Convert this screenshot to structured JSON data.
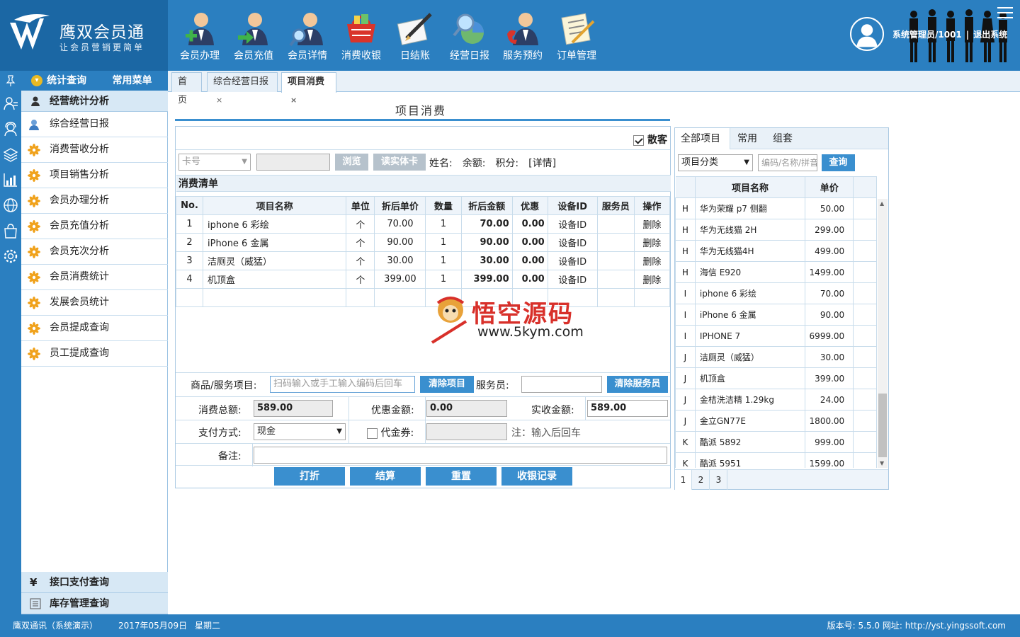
{
  "app": {
    "title": "鹰双会员通",
    "subtitle": "让会员营销更简单",
    "user": "系统管理员/1001",
    "sep": "|",
    "logout": "退出系统"
  },
  "toolbar": [
    {
      "label": "会员办理",
      "icon": "member-register-icon"
    },
    {
      "label": "会员充值",
      "icon": "member-recharge-icon"
    },
    {
      "label": "会员详情",
      "icon": "member-detail-icon"
    },
    {
      "label": "消费收银",
      "icon": "cashier-basket-icon"
    },
    {
      "label": "日结账",
      "icon": "daily-settle-icon"
    },
    {
      "label": "经营日报",
      "icon": "business-report-icon"
    },
    {
      "label": "服务预约",
      "icon": "service-booking-icon"
    },
    {
      "label": "订单管理",
      "icon": "order-manage-icon"
    }
  ],
  "sidebar": {
    "tab_stats": "统计查询",
    "tab_common": "常用菜单",
    "group_title": "经营统计分析",
    "items": [
      {
        "label": "综合经营日报"
      },
      {
        "label": "消费营收分析"
      },
      {
        "label": "项目销售分析"
      },
      {
        "label": "会员办理分析"
      },
      {
        "label": "会员充值分析"
      },
      {
        "label": "会员充次分析"
      },
      {
        "label": "会员消费统计"
      },
      {
        "label": "发展会员统计"
      },
      {
        "label": "会员提成查询"
      },
      {
        "label": "员工提成查询"
      }
    ],
    "bottom_groups": [
      {
        "label": "接口支付查询",
        "icon": "yen-icon"
      },
      {
        "label": "库存管理查询",
        "icon": "list-icon"
      }
    ]
  },
  "tabs": [
    {
      "label": "首页"
    },
    {
      "label": "综合经营日报",
      "close": "×"
    },
    {
      "label": "项目消费",
      "close": "×"
    }
  ],
  "main": {
    "title": "项目消费",
    "walk_in_label": "散客",
    "card_select": "卡号",
    "browse_btn": "浏览",
    "read_card_btn": "读实体卡",
    "info_text": "姓名:　余额:　积分:　[详情]",
    "list_title": "消费清单",
    "columns": [
      "No.",
      "项目名称",
      "单位",
      "折后单价",
      "数量",
      "折后金额",
      "优惠",
      "设备ID",
      "服务员",
      "操作"
    ],
    "rows": [
      {
        "no": "1",
        "name": "iphone 6 彩绘",
        "unit": "个",
        "price": "70.00",
        "qty": "1",
        "amount": "70.00",
        "discount": "0.00",
        "device": "设备ID",
        "op": "删除"
      },
      {
        "no": "2",
        "name": "iPhone 6 金属",
        "unit": "个",
        "price": "90.00",
        "qty": "1",
        "amount": "90.00",
        "discount": "0.00",
        "device": "设备ID",
        "op": "删除"
      },
      {
        "no": "3",
        "name": "洁厕灵（威猛）",
        "unit": "个",
        "price": "30.00",
        "qty": "1",
        "amount": "30.00",
        "discount": "0.00",
        "device": "设备ID",
        "op": "删除"
      },
      {
        "no": "4",
        "name": "机顶盒",
        "unit": "个",
        "price": "399.00",
        "qty": "1",
        "amount": "399.00",
        "discount": "0.00",
        "device": "设备ID",
        "op": "删除"
      }
    ],
    "goods_label": "商品/服务项目:",
    "goods_placeholder": "扫码输入或手工输入编码后回车",
    "clear_items_btn": "清除项目",
    "waiter_label": "服务员:",
    "clear_waiter_btn": "清除服务员",
    "total_label": "消费总额:",
    "total_value": "589.00",
    "discount_label": "优惠金额:",
    "discount_value": "0.00",
    "actual_label": "实收金额:",
    "actual_value": "589.00",
    "pay_label": "支付方式:",
    "pay_value": "现金",
    "voucher_label": "代金券:",
    "voucher_note": "注：输入后回车",
    "remark_label": "备注:",
    "btn_discount": "打折",
    "btn_settle": "结算",
    "btn_reset": "重置",
    "btn_records": "收银记录"
  },
  "right": {
    "tabs": [
      "全部项目",
      "常用",
      "组套"
    ],
    "category": "项目分类",
    "search_placeholder": "编码/名称/拼音",
    "search_btn": "查询",
    "col_name": "项目名称",
    "col_price": "单价",
    "rows": [
      {
        "k": "H",
        "name": "华为荣耀 p7 侧翻",
        "price": "50.00"
      },
      {
        "k": "H",
        "name": "华为无线猫 2H",
        "price": "299.00"
      },
      {
        "k": "H",
        "name": "华为无线猫4H",
        "price": "499.00"
      },
      {
        "k": "H",
        "name": "海信 E920",
        "price": "1499.00"
      },
      {
        "k": "I",
        "name": "iphone 6 彩绘",
        "price": "70.00"
      },
      {
        "k": "I",
        "name": "iPhone 6 金属",
        "price": "90.00"
      },
      {
        "k": "I",
        "name": "IPHONE 7",
        "price": "6999.00"
      },
      {
        "k": "J",
        "name": "洁厕灵（威猛）",
        "price": "30.00"
      },
      {
        "k": "J",
        "name": "机顶盒",
        "price": "399.00"
      },
      {
        "k": "J",
        "name": "金桔洗洁精 1.29kg",
        "price": "24.00"
      },
      {
        "k": "J",
        "name": "金立GN77E",
        "price": "1800.00"
      },
      {
        "k": "K",
        "name": "酷派 5892",
        "price": "999.00"
      },
      {
        "k": "K",
        "name": "酷派 5951",
        "price": "1599.00"
      }
    ],
    "pages": [
      "1",
      "2",
      "3"
    ]
  },
  "watermark": {
    "title": "悟空源码",
    "url": "www.5kym.com"
  },
  "status": {
    "company": "鹰双通讯（系统演示）",
    "date": "2017年05月09日",
    "weekday": "星期二",
    "version": "版本号: 5.5.0 网址: http://yst.yingssoft.com"
  },
  "colors": {
    "brand": "#2b7fc0",
    "brand_dark": "#1b67a4",
    "button": "#3a8fcf",
    "side_bg": "#d7e8f5"
  }
}
